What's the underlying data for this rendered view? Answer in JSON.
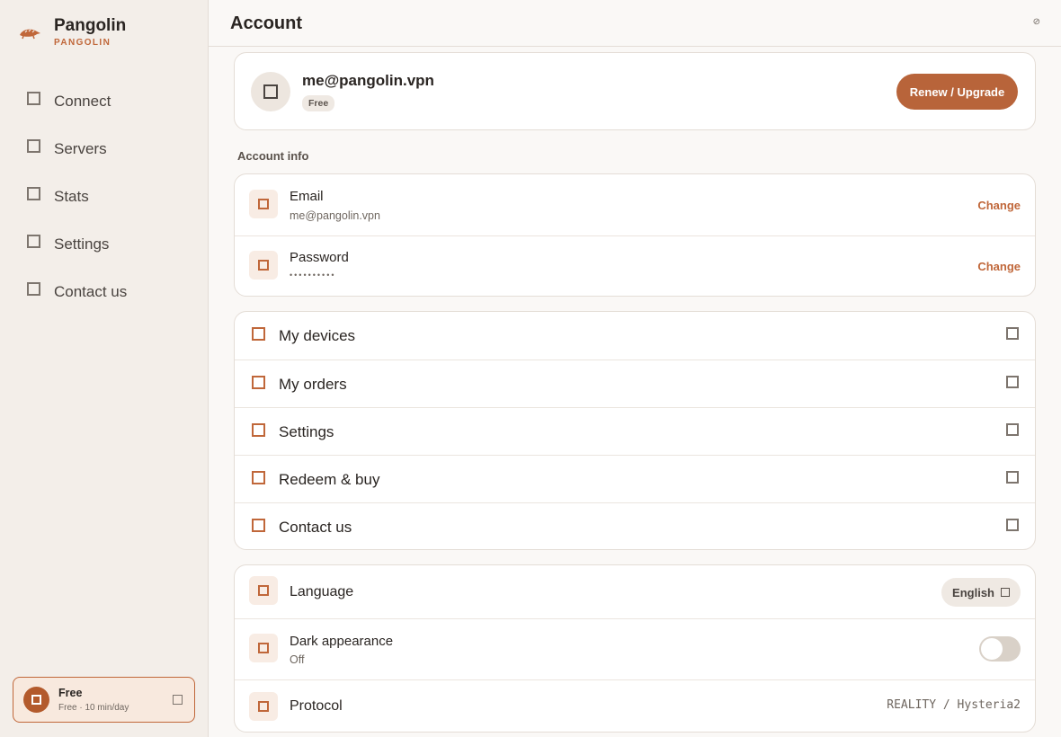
{
  "sidebar": {
    "brand": {
      "name": "Pangolin",
      "sub": "PANGOLIN",
      "logo_icon": "pangolin-logo-icon"
    },
    "items": [
      {
        "label": "Connect",
        "icon": "connect-icon"
      },
      {
        "label": "Servers",
        "icon": "servers-icon"
      },
      {
        "label": "Stats",
        "icon": "stats-icon"
      },
      {
        "label": "Settings",
        "icon": "settings-icon"
      },
      {
        "label": "Contact us",
        "icon": "contact-icon"
      }
    ],
    "plan": {
      "title": "Free",
      "subtitle": "Free · 10 min/day"
    }
  },
  "header": {
    "title": "Account",
    "action_glyph": "⊘"
  },
  "profile": {
    "email": "me@pangolin.vpn",
    "badge": "Free",
    "upgrade_label": "Renew / Upgrade"
  },
  "account_info": {
    "label": "Account info",
    "rows": [
      {
        "title": "Email",
        "value": "me@pangolin.vpn",
        "action": "Change"
      },
      {
        "title": "Password",
        "value": "••••••••••",
        "action": "Change"
      }
    ]
  },
  "menu": [
    {
      "label": "My devices"
    },
    {
      "label": "My orders"
    },
    {
      "label": "Settings"
    },
    {
      "label": "Redeem & buy"
    },
    {
      "label": "Contact us"
    }
  ],
  "prefs": {
    "language": {
      "title": "Language",
      "value": "English"
    },
    "dark": {
      "title": "Dark appearance",
      "value": "Off",
      "enabled": false
    },
    "protocol": {
      "title": "Protocol",
      "value": "REALITY / Hysteria2"
    }
  },
  "colors": {
    "accent": "#c0673a",
    "accent_dark": "#b8643a",
    "sidebar_bg": "#f3eee9",
    "page_bg": "#faf8f6"
  }
}
